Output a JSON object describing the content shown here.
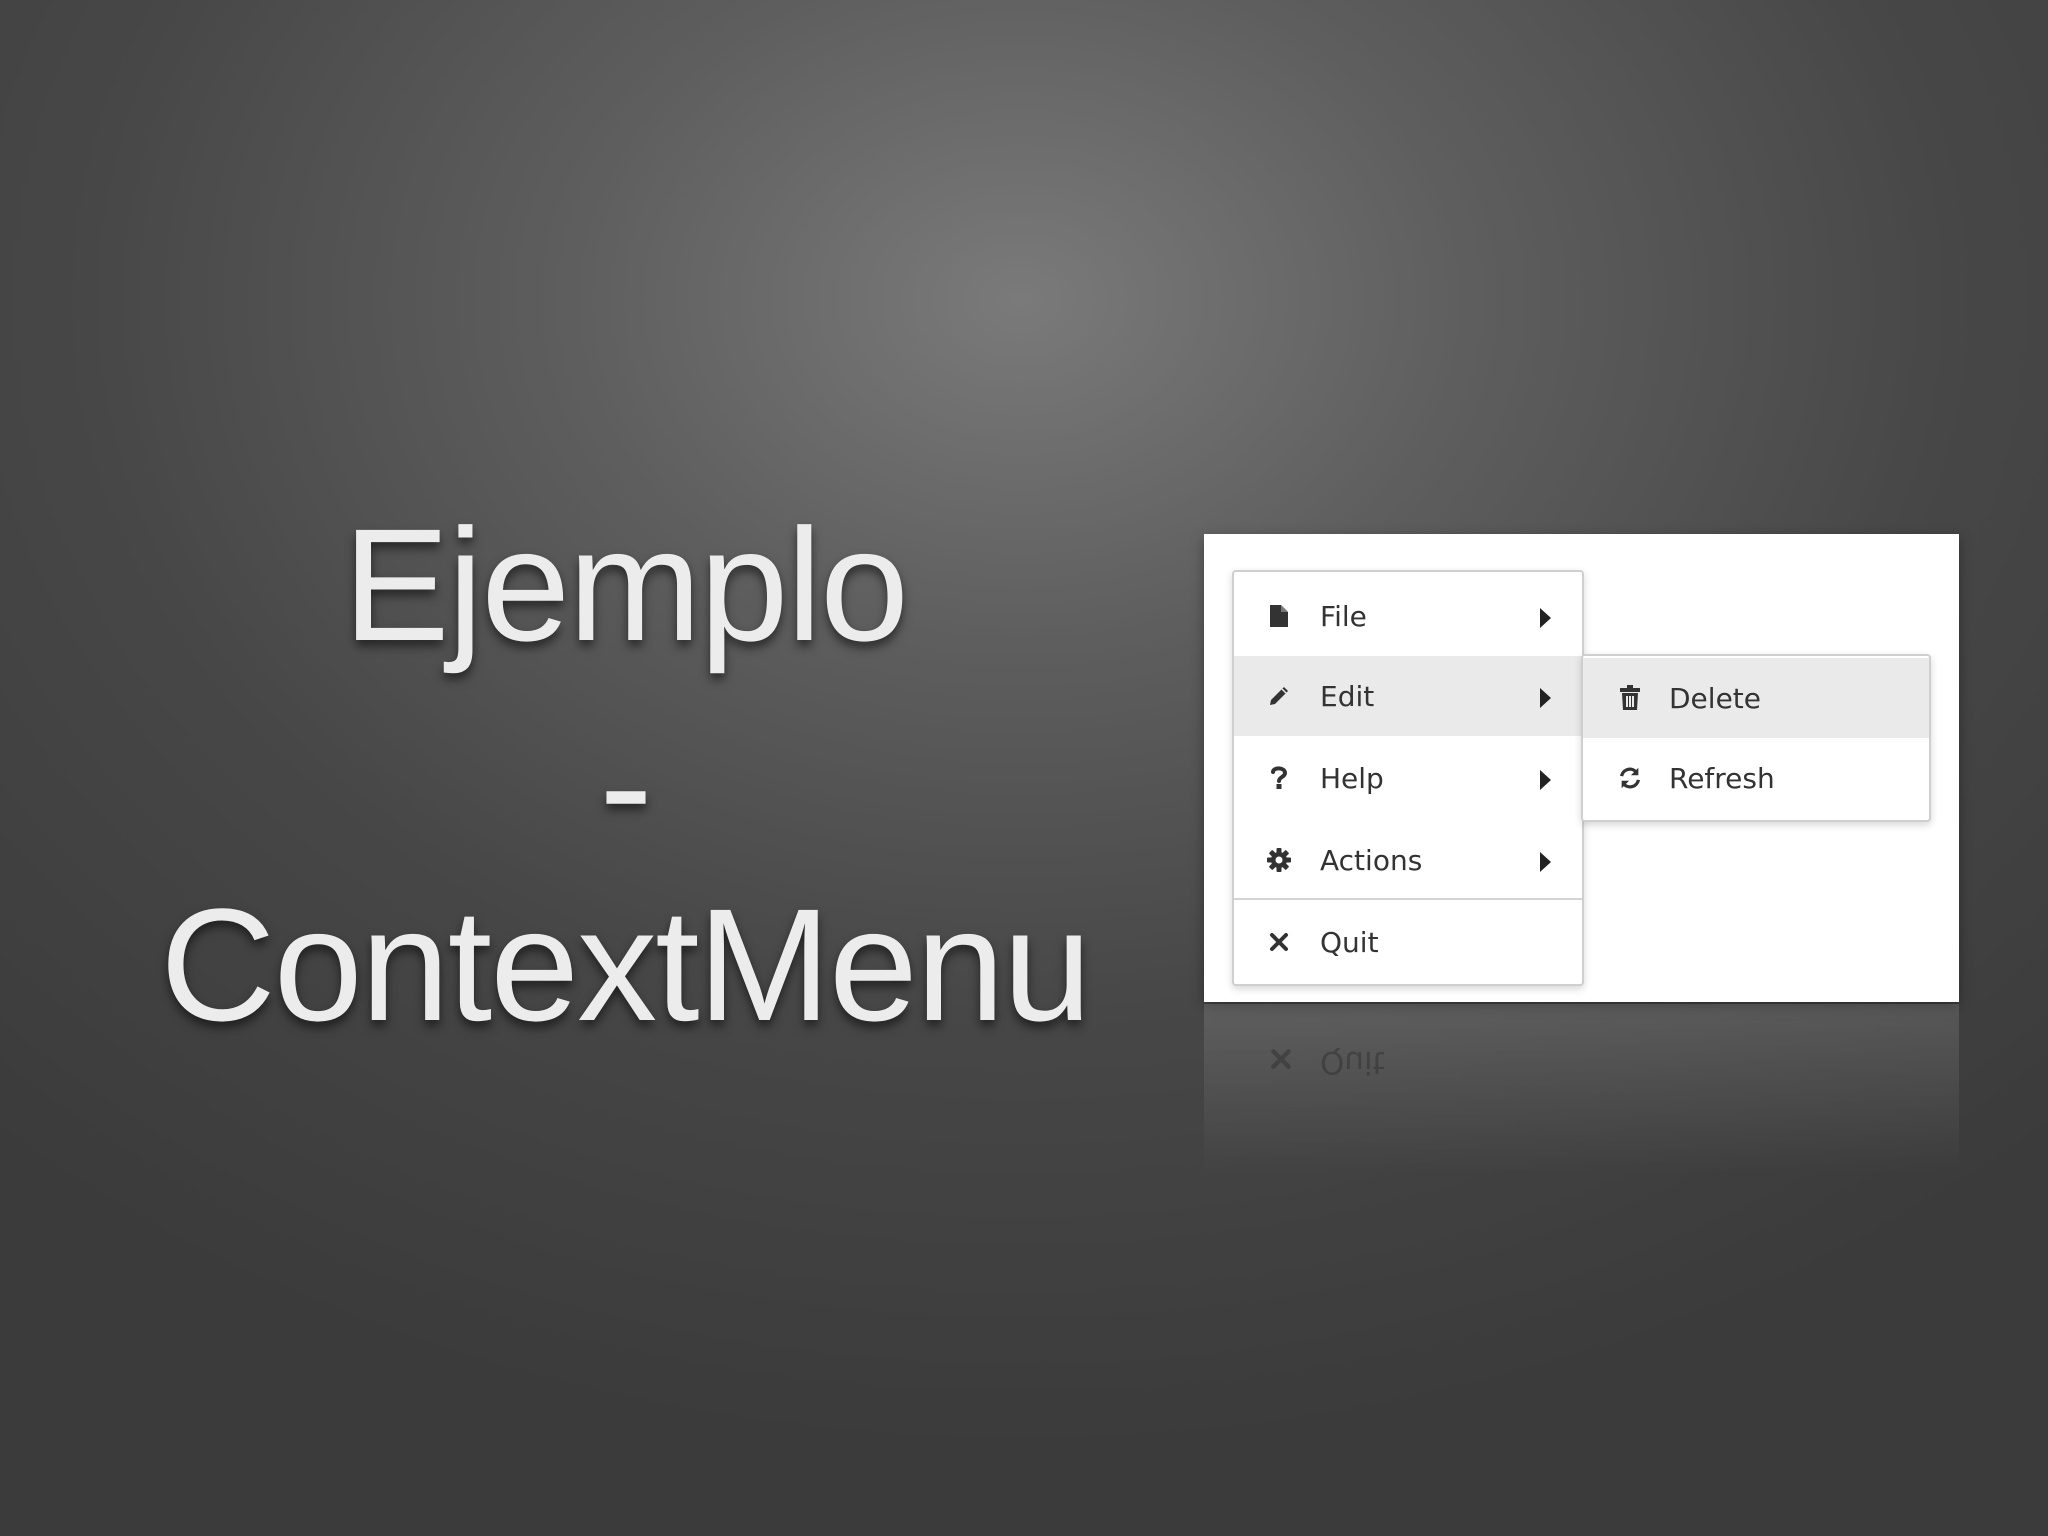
{
  "slide": {
    "title_line1": "Ejemplo",
    "title_line2": "-",
    "title_line3": "ContextMenu"
  },
  "context_menu": {
    "items": [
      {
        "label": "File",
        "icon": "file-icon",
        "has_submenu": true
      },
      {
        "label": "Edit",
        "icon": "pencil-icon",
        "has_submenu": true,
        "active": true
      },
      {
        "label": "Help",
        "icon": "question-icon",
        "has_submenu": true
      },
      {
        "label": "Actions",
        "icon": "gear-icon",
        "has_submenu": true
      },
      {
        "label": "Quit",
        "icon": "close-icon",
        "has_submenu": false
      }
    ],
    "submenu": [
      {
        "label": "Delete",
        "icon": "trash-icon",
        "active": true
      },
      {
        "label": "Refresh",
        "icon": "refresh-icon"
      }
    ]
  },
  "colors": {
    "menu_text": "#333333",
    "active_bg": "#eaeaea",
    "title_text": "#ececec"
  }
}
